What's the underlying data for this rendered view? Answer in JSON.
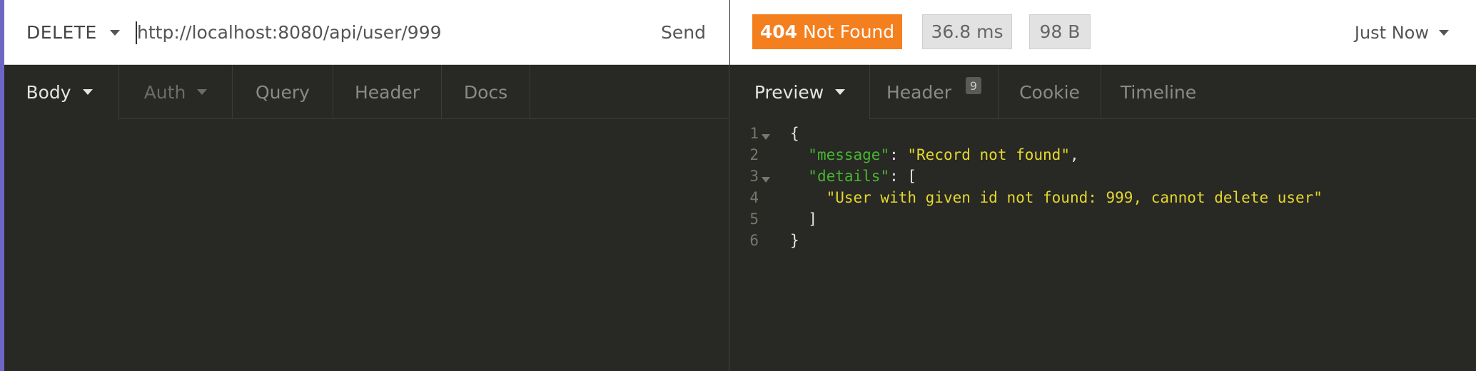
{
  "request": {
    "method": "DELETE",
    "url": "http://localhost:8080/api/user/999",
    "send_label": "Send",
    "tabs": [
      {
        "label": "Body",
        "has_caret": true
      },
      {
        "label": "Auth",
        "has_caret": true
      },
      {
        "label": "Query"
      },
      {
        "label": "Header"
      },
      {
        "label": "Docs"
      }
    ]
  },
  "response": {
    "status_code": "404",
    "status_text": "Not Found",
    "time": "36.8 ms",
    "size": "98 B",
    "history_label": "Just Now",
    "tabs": [
      {
        "label": "Preview",
        "has_caret": true
      },
      {
        "label": "Header",
        "count": "9"
      },
      {
        "label": "Cookie"
      },
      {
        "label": "Timeline"
      }
    ],
    "code_lines": [
      {
        "num": "1",
        "foldable": true
      },
      {
        "num": "2",
        "key": "\"message\"",
        "value": "\"Record not found\""
      },
      {
        "num": "3",
        "key": "\"details\"",
        "foldable": true
      },
      {
        "num": "4",
        "value": "\"User with given id not found: 999, cannot delete user\""
      },
      {
        "num": "5"
      },
      {
        "num": "6"
      }
    ]
  },
  "colors": {
    "accent": "#6f66c4",
    "status_404": "#f47f1f",
    "json_key": "#46b82f",
    "json_string": "#e4d82e",
    "background": "#282824"
  }
}
